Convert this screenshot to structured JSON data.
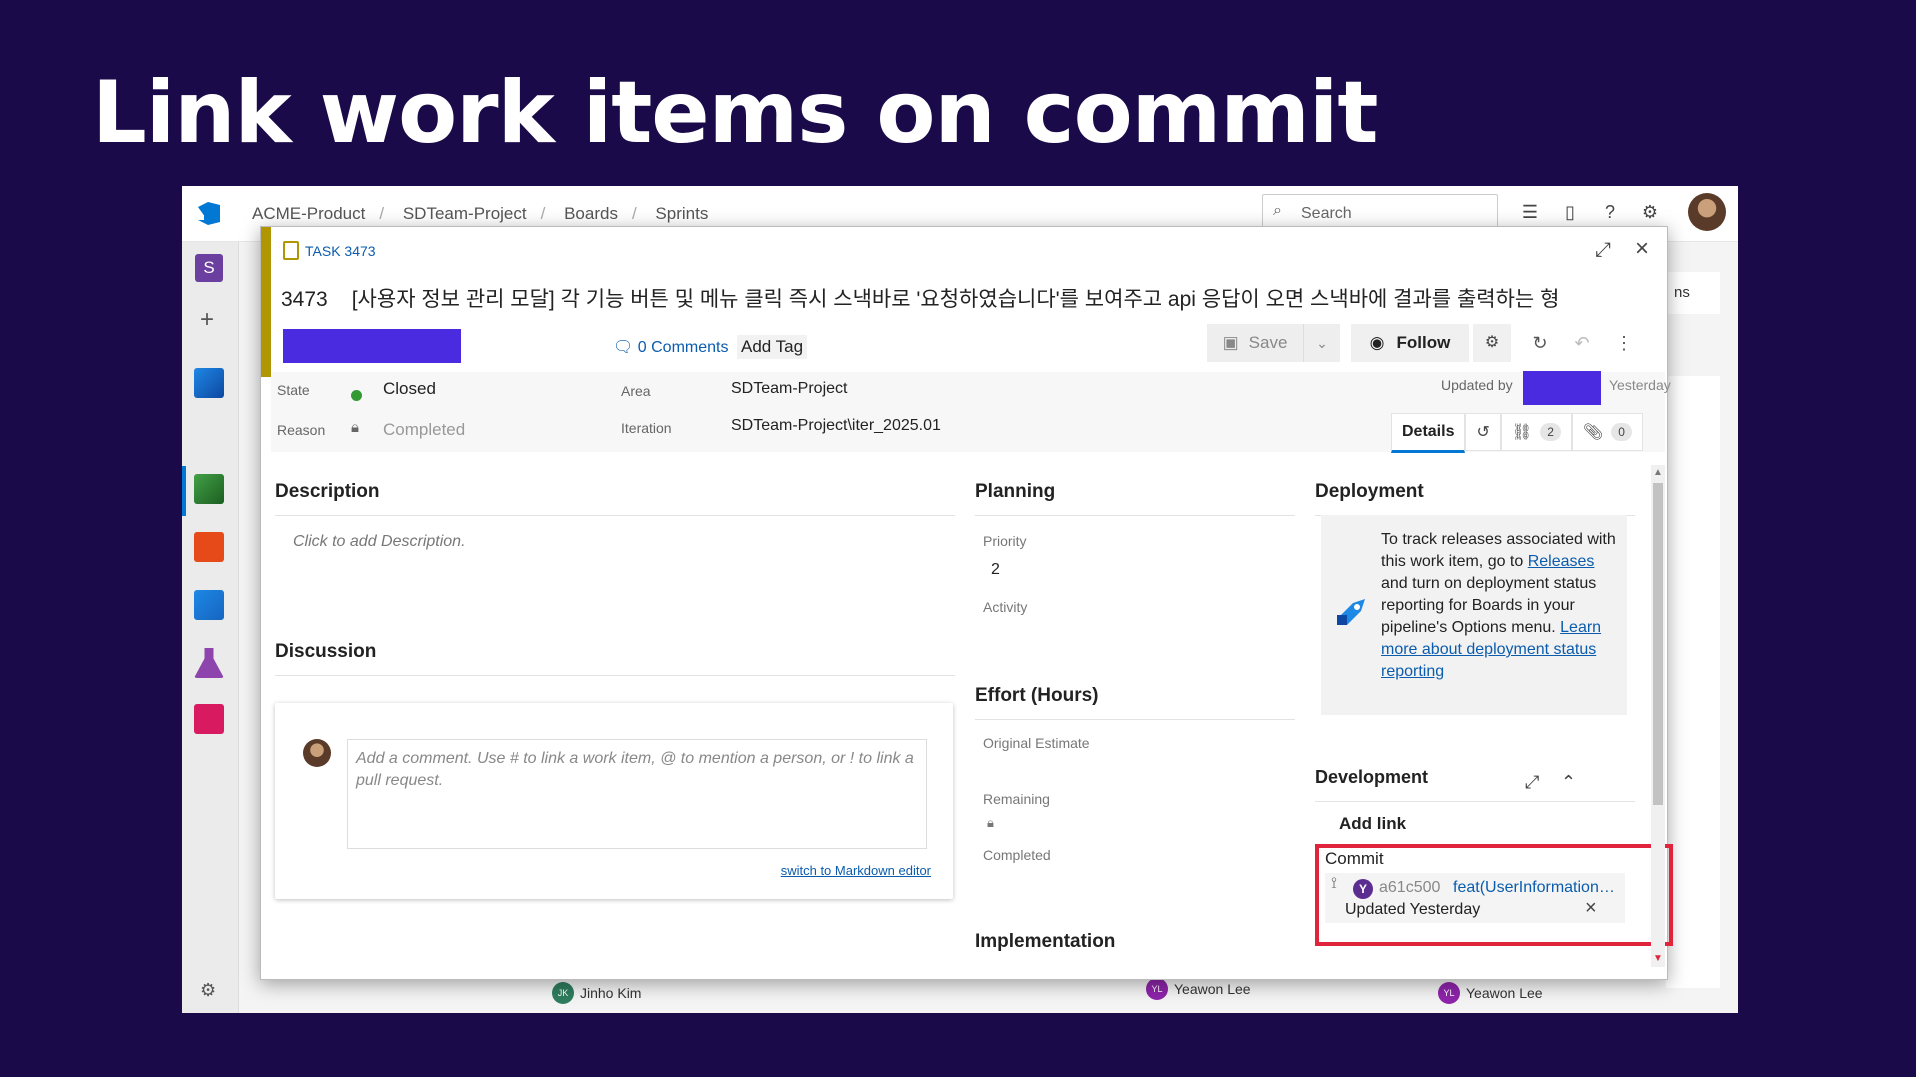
{
  "slide": {
    "title": "Link work items on commit"
  },
  "topbar": {
    "breadcrumbs": [
      "ACME-Product",
      "SDTeam-Project",
      "Boards",
      "Sprints"
    ],
    "search_placeholder": "Search"
  },
  "leftnav": {
    "project_initial": "S"
  },
  "background": {
    "peek_tab": "ns",
    "people": [
      {
        "initials": "JK",
        "name": "Jinho Kim"
      },
      {
        "initials": "YL",
        "name": "Yeawon Lee"
      },
      {
        "initials": "YL",
        "name": "Yeawon Lee"
      }
    ]
  },
  "work_item": {
    "type_label": "TASK 3473",
    "id": "3473",
    "title": "[사용자 정보 관리 모달] 각 기능 버튼 및 메뉴 클릭 즉시 스낵바로 '요청하였습니다'를 보여주고 api 응답이 오면 스낵바에 결과를 출력하는 형",
    "comments_label": "0 Comments",
    "add_tag_label": "Add Tag",
    "toolbar": {
      "save_label": "Save",
      "follow_label": "Follow"
    },
    "fields": {
      "state_label": "State",
      "state_value": "Closed",
      "reason_label": "Reason",
      "reason_value": "Completed",
      "area_label": "Area",
      "area_value": "SDTeam-Project",
      "iteration_label": "Iteration",
      "iteration_value": "SDTeam-Project\\iter_2025.01"
    },
    "updated": {
      "label": "Updated by",
      "when": "Yesterday"
    },
    "tabs": {
      "details": "Details",
      "links_count": "2",
      "attachments_count": "0"
    },
    "description": {
      "heading": "Description",
      "placeholder": "Click to add Description."
    },
    "discussion": {
      "heading": "Discussion",
      "placeholder": "Add a comment. Use # to link a work item, @ to mention a person, or ! to link a pull request.",
      "markdown_link": "switch to Markdown editor"
    },
    "planning": {
      "heading": "Planning",
      "priority_label": "Priority",
      "priority_value": "2",
      "activity_label": "Activity"
    },
    "effort": {
      "heading": "Effort (Hours)",
      "original_label": "Original Estimate",
      "remaining_label": "Remaining",
      "completed_label": "Completed"
    },
    "implementation": {
      "heading": "Implementation"
    },
    "deployment": {
      "heading": "Deployment",
      "text_1": "To track releases associated with this work item, go to ",
      "releases_link": "Releases",
      "text_2": " and turn on deployment status reporting for Boards in your pipeline's Options menu. ",
      "learn_more_link": "Learn more about deployment status reporting"
    },
    "development": {
      "heading": "Development",
      "add_link": "Add link",
      "commit_label": "Commit",
      "commit_author_initial": "Y",
      "commit_hash": "a61c500",
      "commit_message": "feat(UserInformationModal)",
      "commit_updated": "Updated Yesterday"
    }
  },
  "colors": {
    "background": "#1a0a4a",
    "accent": "#0078d4",
    "task_yellow": "#b09600",
    "highlight": "#e0243c",
    "redaction": "#4a2be0"
  }
}
